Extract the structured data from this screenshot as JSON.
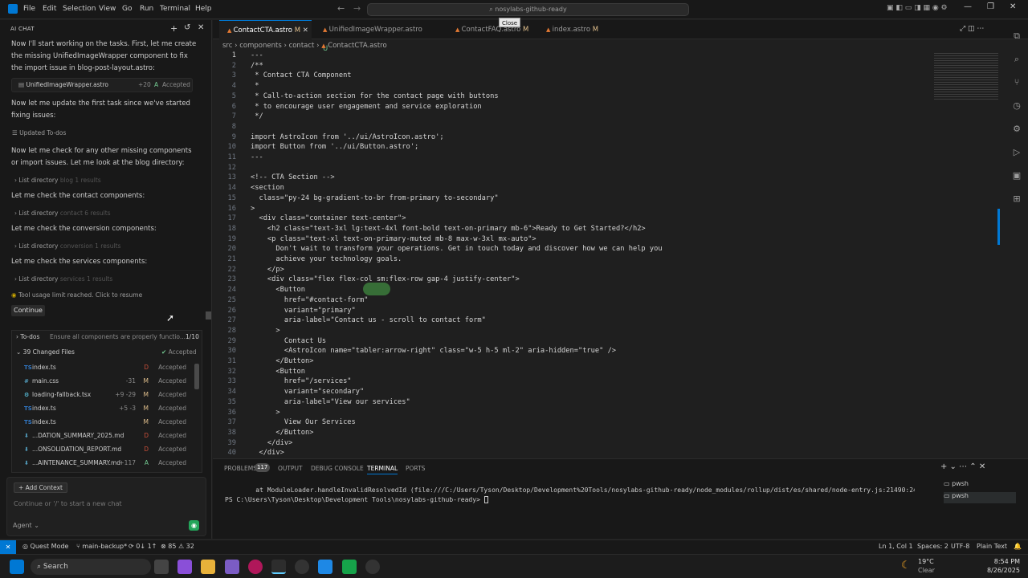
{
  "menu": [
    "File",
    "Edit",
    "Selection",
    "View",
    "Go",
    "Run",
    "Terminal",
    "Help"
  ],
  "command_center": "nosylabs-github-ready",
  "tooltip": "Close",
  "chat": {
    "header": "AI CHAT",
    "messages": [
      "Now I'll start working on the tasks. First, let me create the missing UnifiedImageWrapper component to fix the import issue in blog-post-layout.astro:",
      "Now let me update the first task since we've started fixing issues:",
      "Now let me check for any other missing components or import issues. Let me look at the blog directory:",
      "Let me check the contact components:",
      "Let me check the conversion components:",
      "Let me check the services components:"
    ],
    "file_card": {
      "name": "UnifiedImageWrapper.astro",
      "stat": "+20",
      "status": "A",
      "state": "Accepted"
    },
    "updated_todos": "Updated To-dos",
    "list_label": "List directory",
    "lists": [
      {
        "dir": "blog",
        "count": "1 results"
      },
      {
        "dir": "contact",
        "count": "6 results"
      },
      {
        "dir": "conversion",
        "count": "1 results"
      },
      {
        "dir": "services",
        "count": "1 results"
      }
    ],
    "limit_text": "Tool usage limit reached. Click to resume",
    "continue_label": "Continue",
    "todos": {
      "label": "To-dos",
      "text": "Ensure all components are properly functio...",
      "count": "1/10"
    },
    "changed": {
      "label": "39 Changed Files",
      "state": "Accepted"
    },
    "files": [
      {
        "icon": "TS",
        "name": "index.ts",
        "stat": "",
        "status": "D",
        "state": "Accepted"
      },
      {
        "icon": "#",
        "name": "main.css",
        "stat": "-31",
        "status": "M",
        "state": "Accepted"
      },
      {
        "icon": "⚙",
        "name": "loading-fallback.tsx",
        "stat": "+9 -29",
        "status": "M",
        "state": "Accepted"
      },
      {
        "icon": "TS",
        "name": "index.ts",
        "stat": "+5 -3",
        "status": "M",
        "state": "Accepted"
      },
      {
        "icon": "TS",
        "name": "index.ts",
        "stat": "",
        "status": "M",
        "state": "Accepted"
      },
      {
        "icon": "⬇",
        "name": "...DATION_SUMMARY_2025.md",
        "stat": "",
        "status": "D",
        "state": "Accepted"
      },
      {
        "icon": "⬇",
        "name": "...ONSOLIDATION_REPORT.md",
        "stat": "",
        "status": "D",
        "state": "Accepted"
      },
      {
        "icon": "⬇",
        "name": "...AINTENANCE_SUMMARY.md",
        "stat": "+117",
        "status": "A",
        "state": "Accepted"
      }
    ],
    "add_context": "+ Add Context",
    "input_placeholder": "Continue or '/' to start a new chat",
    "mode": "Agent"
  },
  "tabs": [
    {
      "label": "ContactCTA.astro",
      "badge": "M",
      "active": true
    },
    {
      "label": "UnifiedImageWrapper.astro",
      "badge": "U",
      "active": false
    },
    {
      "label": "ContactFAQ.astro",
      "badge": "M",
      "active": false
    },
    {
      "label": "index.astro",
      "badge": "M",
      "active": false
    }
  ],
  "breadcrumb": [
    "src",
    "components",
    "contact",
    "ContactCTA.astro"
  ],
  "code": [
    "---",
    "/**",
    " * Contact CTA Component",
    " *",
    " * Call-to-action section for the contact page with buttons",
    " * to encourage user engagement and service exploration",
    " */",
    "",
    "import AstroIcon from '../ui/AstroIcon.astro';",
    "import Button from '../ui/Button.astro';",
    "---",
    "",
    "<!-- CTA Section -->",
    "<section",
    "  class=\"py-24 bg-gradient-to-br from-primary to-secondary\"",
    ">",
    "  <div class=\"container text-center\">",
    "    <h2 class=\"text-3xl lg:text-4xl font-bold text-on-primary mb-6\">Ready to Get Started?</h2>",
    "    <p class=\"text-xl text-on-primary-muted mb-8 max-w-3xl mx-auto\">",
    "      Don't wait to transform your operations. Get in touch today and discover how we can help you",
    "      achieve your technology goals.",
    "    </p>",
    "    <div class=\"flex flex-col sm:flex-row gap-4 justify-center\">",
    "      <Button",
    "        href=\"#contact-form\"",
    "        variant=\"primary\"",
    "        aria-label=\"Contact us - scroll to contact form\"",
    "      >",
    "        Contact Us",
    "        <AstroIcon name=\"tabler:arrow-right\" class=\"w-5 h-5 ml-2\" aria-hidden=\"true\" />",
    "      </Button>",
    "      <Button",
    "        href=\"/services\"",
    "        variant=\"secondary\"",
    "        aria-label=\"View our services\"",
    "      >",
    "        View Our Services",
    "      </Button>",
    "    </div>",
    "  </div>"
  ],
  "panel": {
    "tabs": [
      "PROBLEMS",
      "OUTPUT",
      "DEBUG CONSOLE",
      "TERMINAL",
      "PORTS"
    ],
    "problems_count": "117",
    "lines": [
      "    at ModuleLoader.handleInvalidResolvedId (file:///C:/Users/Tyson/Desktop/Development%20Tools/nosylabs-github-ready/node_modules/rollup/dist/es/shared/node-entry.js:21490:24)",
      "PS C:\\Users\\Tyson\\Desktop\\Development Tools\\nosylabs-github-ready> "
    ],
    "terminals": [
      "pwsh",
      "pwsh"
    ]
  },
  "status": {
    "left": [
      "Quest Mode",
      "main-backup*",
      "⟳ 0↓ 1↑",
      "⊗ 85 ⚠ 32"
    ],
    "right": [
      "Ln 1, Col 1",
      "Spaces: 2",
      "UTF-8",
      "Plain Text"
    ]
  },
  "taskbar": {
    "search": "Search",
    "temp": "19°C",
    "weather": "Clear",
    "time": "8:54 PM",
    "date": "8/26/2025"
  },
  "colors": {
    "accent": "#0078d4",
    "accepted": "#4ec9b0",
    "deleted": "#c74e39",
    "modified": "#e2c08d",
    "added": "#73c991"
  }
}
